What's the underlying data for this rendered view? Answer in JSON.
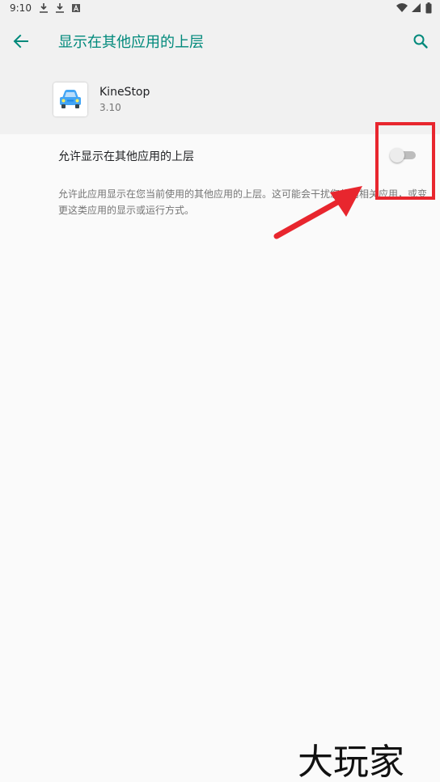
{
  "status_bar": {
    "time": "9:10"
  },
  "app_bar": {
    "title": "显示在其他应用的上层"
  },
  "app": {
    "name": "KineStop",
    "version": "3.10"
  },
  "setting": {
    "label": "允许显示在其他应用的上层",
    "enabled": false,
    "description": "允许此应用显示在您当前使用的其他应用的上层。这可能会干扰您使用相关应用，或变更这类应用的显示或运行方式。"
  },
  "watermark": "大玩家",
  "colors": {
    "accent": "#00897b",
    "annotation": "#e8262e",
    "background": "#fafafa",
    "header_bg": "#f1f1f1"
  },
  "icons": {
    "back": "arrow-back-icon",
    "search": "search-icon",
    "app": "car-icon",
    "status": [
      "download-icon",
      "download-icon",
      "a-badge-icon",
      "wifi-icon",
      "signal-icon",
      "battery-icon"
    ]
  }
}
